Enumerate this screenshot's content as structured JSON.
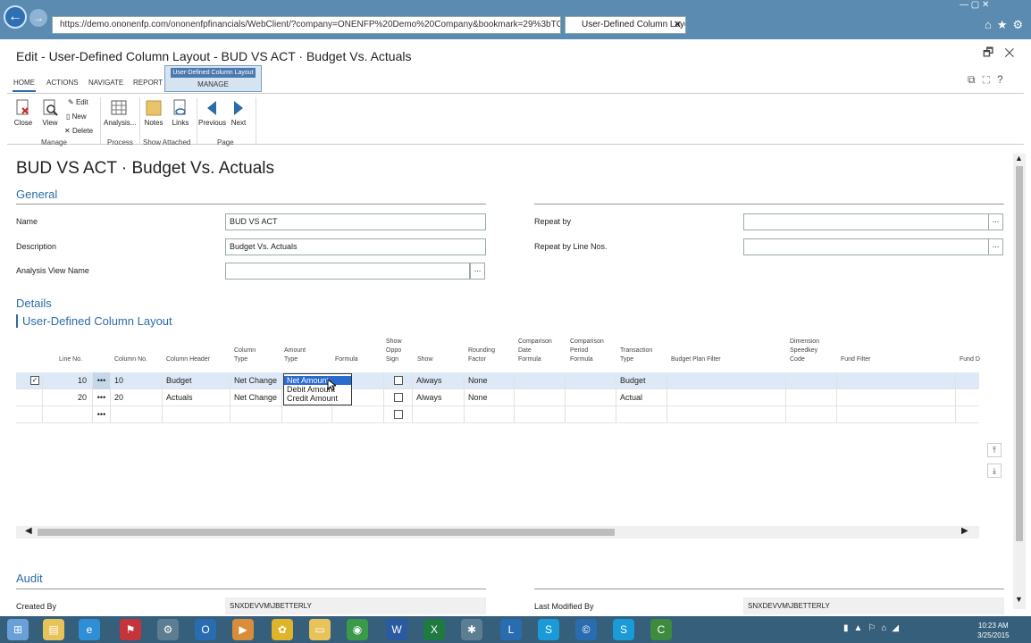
{
  "browser": {
    "url": "https://demo.ononenfp.com/ononenfpfinancials/WebClient/?company=ONENFP%20Demo%20Company&bookmark=29%3bTC",
    "tab_title": "User-Defined Column Layo...",
    "tab_close": "✕"
  },
  "window": {
    "title": "Edit - User-Defined Column Layout - BUD VS ACT · Budget Vs. Actuals",
    "close": "✕",
    "restore": "🗗"
  },
  "ribbon": {
    "tabs": [
      "HOME",
      "ACTIONS",
      "NAVIGATE",
      "REPORT"
    ],
    "context_header": "User-Defined Column Layout",
    "context_tab": "MANAGE",
    "buttons": {
      "close": "Close",
      "view": "View",
      "edit": "Edit",
      "new": "New",
      "delete": "Delete",
      "analysis": "Analysis...",
      "notes": "Notes",
      "links": "Links",
      "previous": "Previous",
      "next": "Next"
    },
    "groups": {
      "manage": "Manage",
      "process": "Process",
      "show_attached": "Show Attached",
      "page": "Page"
    }
  },
  "page": {
    "title": "BUD VS ACT · Budget Vs. Actuals",
    "general_header": "General",
    "details_header": "Details",
    "subsection": "User-Defined Column Layout",
    "audit_header": "Audit"
  },
  "general": {
    "name_label": "Name",
    "name_value": "BUD VS ACT",
    "description_label": "Description",
    "description_value": "Budget Vs. Actuals",
    "analysis_label": "Analysis View Name",
    "analysis_value": "",
    "repeat_by_label": "Repeat by",
    "repeat_by_value": "",
    "repeat_line_label": "Repeat by Line Nos.",
    "repeat_line_value": "",
    "dots": "..."
  },
  "grid": {
    "headers": {
      "line_no": "Line No.",
      "column_no": "Column No.",
      "column_header": "Column Header",
      "column_type": "Column\nType",
      "amount_type": "Amount\nType",
      "formula": "Formula",
      "show_oppo": "Show\nOppo\nSign",
      "show": "Show",
      "rounding": "Rounding\nFactor",
      "comp_date": "Comparison\nDate\nFormula",
      "comp_period": "Comparison\nPeriod\nFormula",
      "transaction_type": "Transaction\nType",
      "budget_plan": "Budget Plan Filter",
      "dimension": "Dimension\nSpeedkey\nCode",
      "fund_filter": "Fund Filter",
      "fund_d": "Fund D"
    },
    "rows": [
      {
        "line_no": "10",
        "column_no": "10",
        "header": "Budget",
        "column_type": "Net Change",
        "amount_type": "Net Amount",
        "show": "Always",
        "rounding": "None",
        "transaction_type": "Budget"
      },
      {
        "line_no": "20",
        "column_no": "20",
        "header": "Actuals",
        "column_type": "Net Change",
        "amount_type": "",
        "show": "Always",
        "rounding": "None",
        "transaction_type": "Actual"
      }
    ],
    "row_menu": "•••",
    "dropdown_options": [
      "Net Amount",
      "Debit Amount",
      "Credit Amount"
    ]
  },
  "audit": {
    "created_by_label": "Created By",
    "created_by_value": "SNXDEVVM\\JBETTERLY",
    "modified_by_label": "Last Modified By",
    "modified_by_value": "SNXDEVVM\\JBETTERLY"
  },
  "taskbar": {
    "time": "10:23 AM",
    "date": "3/25/2015"
  }
}
